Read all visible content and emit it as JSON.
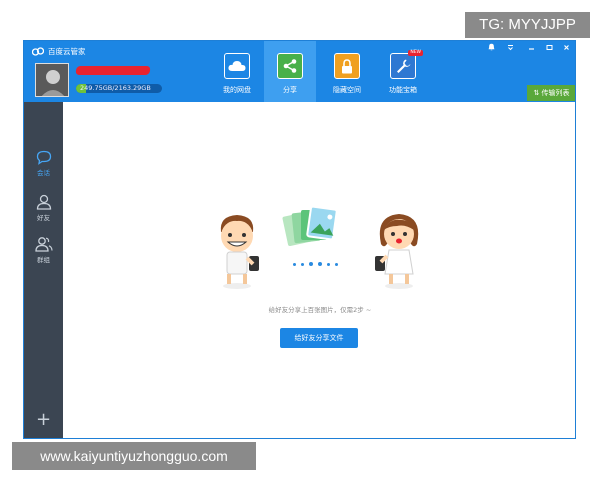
{
  "watermark_top": "TG: MYYJJPP",
  "watermark_bottom": "www.kaiyuntiyuzhongguo.com",
  "app": {
    "title": "百度云管家"
  },
  "user": {
    "quota": "249.75GB/2163.29GB",
    "quota_used_fraction": 0.115
  },
  "tabs": [
    {
      "label": "我的网盘",
      "icon": "cloud-icon",
      "active": false
    },
    {
      "label": "分享",
      "icon": "share-icon",
      "active": true
    },
    {
      "label": "隐藏空间",
      "icon": "lock-icon",
      "active": false
    },
    {
      "label": "功能宝箱",
      "icon": "wrench-icon",
      "active": false,
      "badge": "NEW"
    }
  ],
  "transfer_button": "传输列表",
  "sidebar": {
    "items": [
      {
        "label": "会话",
        "icon": "chat-bubble-icon",
        "active": true
      },
      {
        "label": "好友",
        "icon": "person-icon",
        "active": false
      },
      {
        "label": "群组",
        "icon": "group-icon",
        "active": false
      }
    ],
    "add": "+"
  },
  "main": {
    "hint": "给好友分享上百张图片，仅需2步 ~",
    "share_button": "给好友分享文件"
  },
  "colors": {
    "accent": "#1c86e4",
    "sidebar": "#3b4552",
    "transfer": "#5aa83a"
  }
}
